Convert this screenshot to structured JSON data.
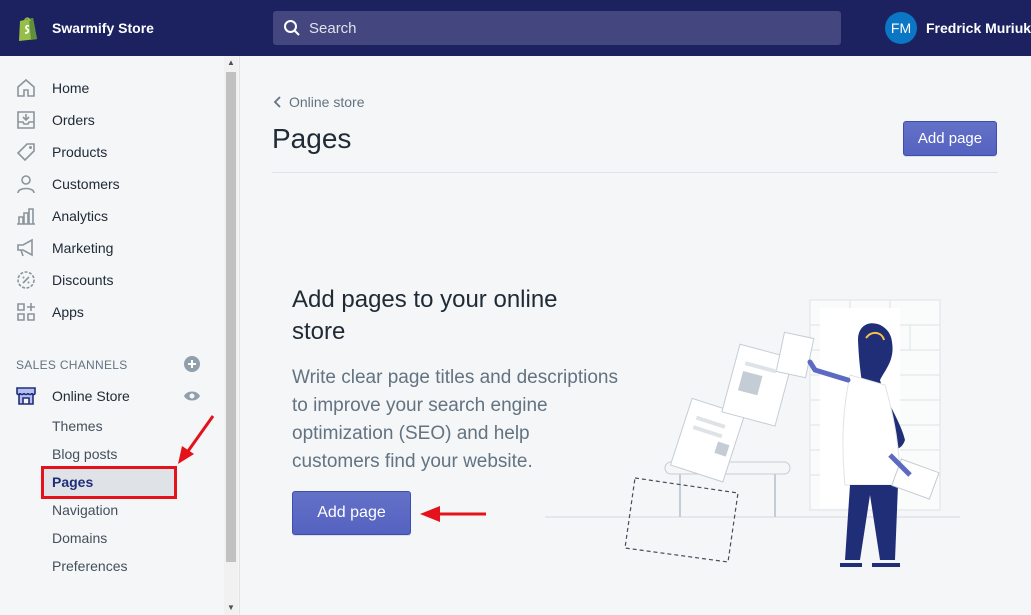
{
  "topbar": {
    "store_name": "Swarmify Store",
    "search_placeholder": "Search",
    "user_initials": "FM",
    "user_name": "Fredrick Muriuki"
  },
  "sidebar": {
    "items": [
      {
        "label": "Home",
        "icon": "home-icon"
      },
      {
        "label": "Orders",
        "icon": "orders-icon"
      },
      {
        "label": "Products",
        "icon": "tag-icon"
      },
      {
        "label": "Customers",
        "icon": "person-icon"
      },
      {
        "label": "Analytics",
        "icon": "bar-chart-icon"
      },
      {
        "label": "Marketing",
        "icon": "megaphone-icon"
      },
      {
        "label": "Discounts",
        "icon": "discount-icon"
      },
      {
        "label": "Apps",
        "icon": "apps-icon"
      }
    ],
    "sales_channels_title": "SALES CHANNELS",
    "online_store_label": "Online Store",
    "sub_items": [
      "Themes",
      "Blog posts",
      "Pages",
      "Navigation",
      "Domains",
      "Preferences"
    ],
    "active_sub_item": "Pages"
  },
  "main": {
    "breadcrumb": "Online store",
    "title": "Pages",
    "add_page_label": "Add page",
    "empty_state": {
      "heading": "Add pages to your online store",
      "description": "Write clear page titles and descriptions to improve your search engine optimization (SEO) and help customers find your website.",
      "button_label": "Add page"
    }
  },
  "colors": {
    "topbar": "#1c2260",
    "primary_button": "#5c6ac4",
    "annotation": "#e4121b"
  }
}
